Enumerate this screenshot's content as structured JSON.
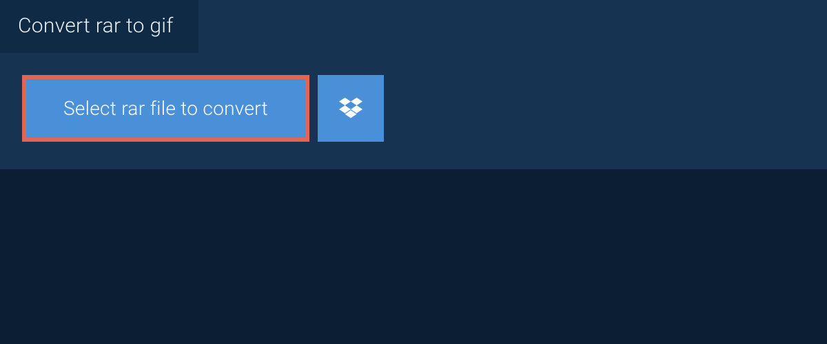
{
  "tab": {
    "title": "Convert rar to gif"
  },
  "buttons": {
    "select_label": "Select rar file to convert"
  },
  "colors": {
    "background": "#0b1e33",
    "panel": "#163352",
    "tab": "#0f2a44",
    "button": "#4a90d9",
    "highlight_border": "#e06553",
    "text_light": "#e8eef3",
    "text_white": "#ffffff"
  }
}
